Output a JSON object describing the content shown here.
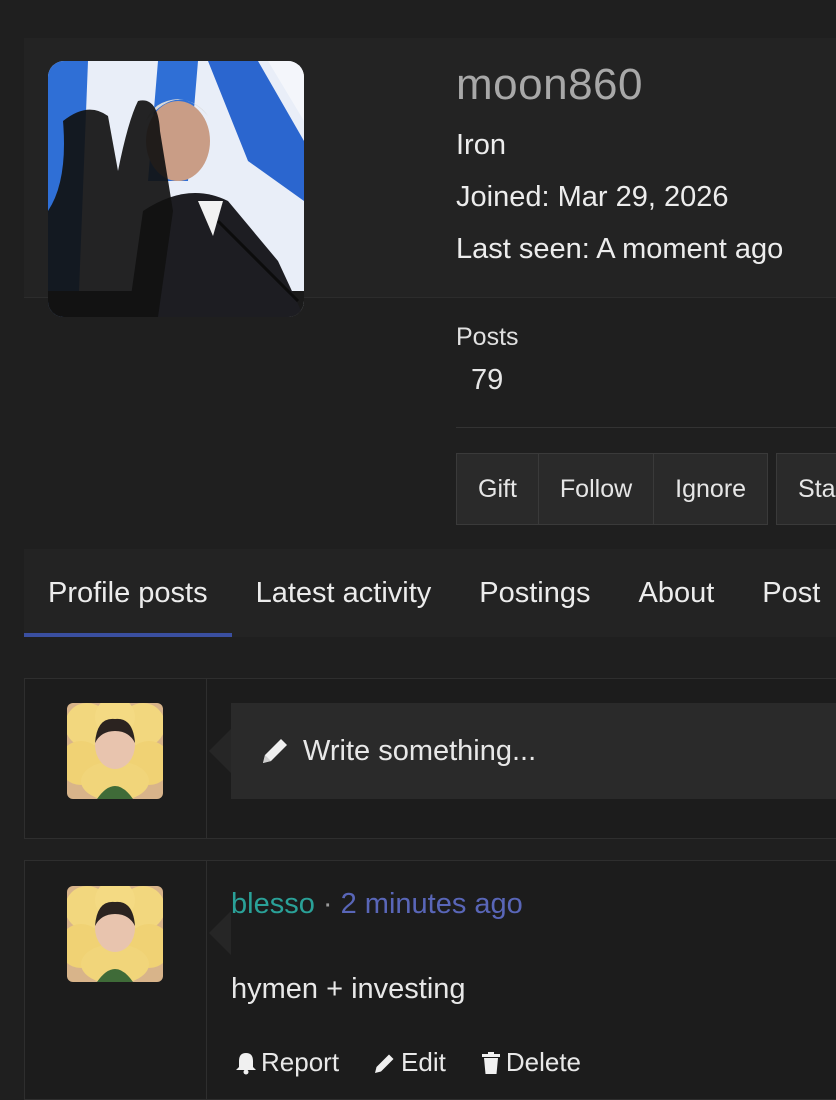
{
  "profile": {
    "username": "moon860",
    "rank": "Iron",
    "joined": "Joined: Mar 29, 2026",
    "last_seen": "Last seen: A moment ago",
    "posts_label": "Posts",
    "posts_count": "79"
  },
  "actions": {
    "gift": "Gift",
    "follow": "Follow",
    "ignore": "Ignore",
    "start": "Sta"
  },
  "tabs": [
    {
      "label": "Profile posts",
      "active": true
    },
    {
      "label": "Latest activity"
    },
    {
      "label": "Postings"
    },
    {
      "label": "About"
    },
    {
      "label": "Post"
    }
  ],
  "composer": {
    "placeholder": "Write something..."
  },
  "post": {
    "author": "blesso",
    "separator": "·",
    "time": "2 minutes ago",
    "text": "hymen + investing",
    "report": "Report",
    "edit": "Edit",
    "delete": "Delete"
  },
  "colors": {
    "accent": "#3a4fa0",
    "author": "#2aa198",
    "time": "#5966b8"
  }
}
